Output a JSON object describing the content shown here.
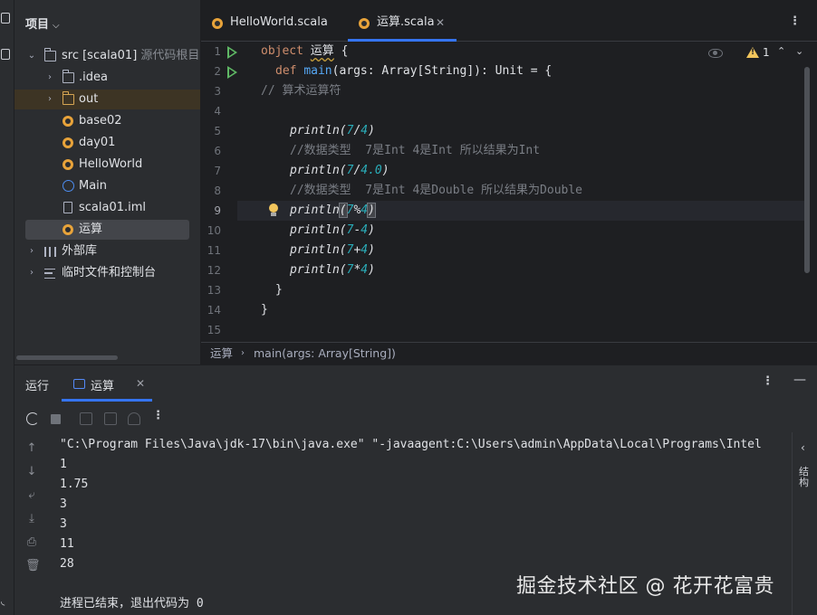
{
  "project": {
    "header": "项目",
    "tree": [
      {
        "label": "src [scala01]",
        "hint": "源代码根目录",
        "icon": "folder-icon",
        "expanded": true
      },
      {
        "label": ".idea",
        "icon": "folder-icon"
      },
      {
        "label": "out",
        "icon": "folder-icon"
      },
      {
        "label": "base02",
        "icon": "scala-object-icon"
      },
      {
        "label": "day01",
        "icon": "scala-object-icon"
      },
      {
        "label": "HelloWorld",
        "icon": "scala-object-icon"
      },
      {
        "label": "Main",
        "icon": "scala-main-icon"
      },
      {
        "label": "scala01.iml",
        "icon": "module-file-icon"
      },
      {
        "label": "运算",
        "icon": "scala-object-icon",
        "selected": true
      },
      {
        "label": "外部库",
        "icon": "library-icon"
      },
      {
        "label": "临时文件和控制台",
        "icon": "scratch-icon"
      }
    ]
  },
  "editor": {
    "tabs": [
      {
        "label": "HelloWorld.scala",
        "active": false
      },
      {
        "label": "运算.scala",
        "active": true
      }
    ],
    "warnings": "1",
    "line_numbers": [
      "1",
      "2",
      "3",
      "4",
      "5",
      "6",
      "7",
      "8",
      "9",
      "10",
      "11",
      "12",
      "13",
      "14",
      "15"
    ],
    "code": {
      "l1_kw": "object",
      "l1_name": "运算",
      "l1_rest": " {",
      "l2_kw": "def",
      "l2_name": "main",
      "l2_rest": "(args: Array[String]): Unit = {",
      "l3": "// 算术运算符",
      "l5_fn": "println",
      "l5_open": "(",
      "l5_a": "7",
      "l5_op": "/",
      "l5_b": "4",
      "l5_close": ")",
      "l6": "//数据类型  7是Int 4是Int 所以结果为Int",
      "l7_fn": "println",
      "l7_open": "(",
      "l7_a": "7",
      "l7_op": "/",
      "l7_b": "4.0",
      "l7_close": ")",
      "l8": "//数据类型  7是Int 4是Double 所以结果为Double",
      "l9_fn": "println",
      "l9_open": "(",
      "l9_a": "7",
      "l9_op": "%",
      "l9_b": "4",
      "l9_close": ")",
      "l10_fn": "println",
      "l10_open": "(",
      "l10_a": "7",
      "l10_op": "-",
      "l10_b": "4",
      "l10_close": ")",
      "l11_fn": "println",
      "l11_open": "(",
      "l11_a": "7",
      "l11_op": "+",
      "l11_b": "4",
      "l11_close": ")",
      "l12_fn": "println",
      "l12_open": "(",
      "l12_a": "7",
      "l12_op": "*",
      "l12_b": "4",
      "l12_close": ")",
      "l13": "}",
      "l14": "}"
    },
    "breadcrumb": [
      "运算",
      "main(args: Array[String])"
    ]
  },
  "run": {
    "title": "运行",
    "tab_label": "运算",
    "console": [
      "\"C:\\Program Files\\Java\\jdk-17\\bin\\java.exe\" \"-javaagent:C:\\Users\\admin\\AppData\\Local\\Programs\\Intel",
      "1",
      "1.75",
      "3",
      "3",
      "11",
      "28",
      "",
      "进程已结束，退出代码为 0"
    ],
    "side_label": "结构"
  },
  "watermark": "掘金技术社区 @ 花开花富贵",
  "colors": {
    "keyword": "#cf8e6d",
    "function": "#56a8f5",
    "number": "#2aacb8",
    "comment": "#7a7e85",
    "accent": "#3574f0",
    "run_green": "#5fb865"
  }
}
